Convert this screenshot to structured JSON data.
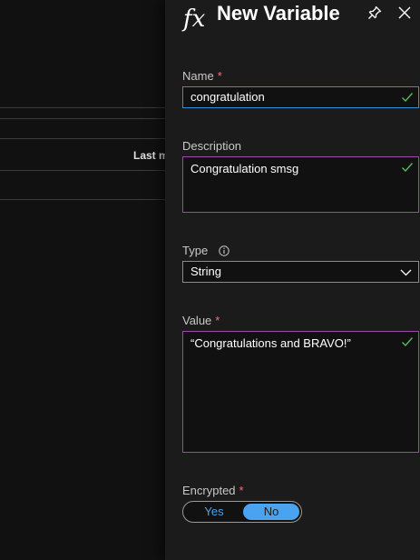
{
  "background": {
    "column_header": "Last modified"
  },
  "panel": {
    "icon": "fx-icon",
    "title": "New Variable",
    "pin_icon": "pin-icon",
    "close_icon": "close-icon"
  },
  "form": {
    "name": {
      "label": "Name",
      "required_mark": "*",
      "value": "congratulation",
      "valid": true
    },
    "description": {
      "label": "Description",
      "value": "Congratulation smsg",
      "valid": true
    },
    "type": {
      "label": "Type",
      "info_icon": "info-icon",
      "selected": "String"
    },
    "value": {
      "label": "Value",
      "required_mark": "*",
      "value": "“Congratulations and BRAVO!”",
      "valid": true
    },
    "encrypted": {
      "label": "Encrypted",
      "required_mark": "*",
      "options": [
        "Yes",
        "No"
      ],
      "selected": "No"
    }
  },
  "colors": {
    "accent": "#4aa3f0",
    "focus_border": "#2e8fd4",
    "valid_check": "#5bb85b",
    "textarea_border": "#9b4aa8",
    "required": "#f1707b"
  }
}
